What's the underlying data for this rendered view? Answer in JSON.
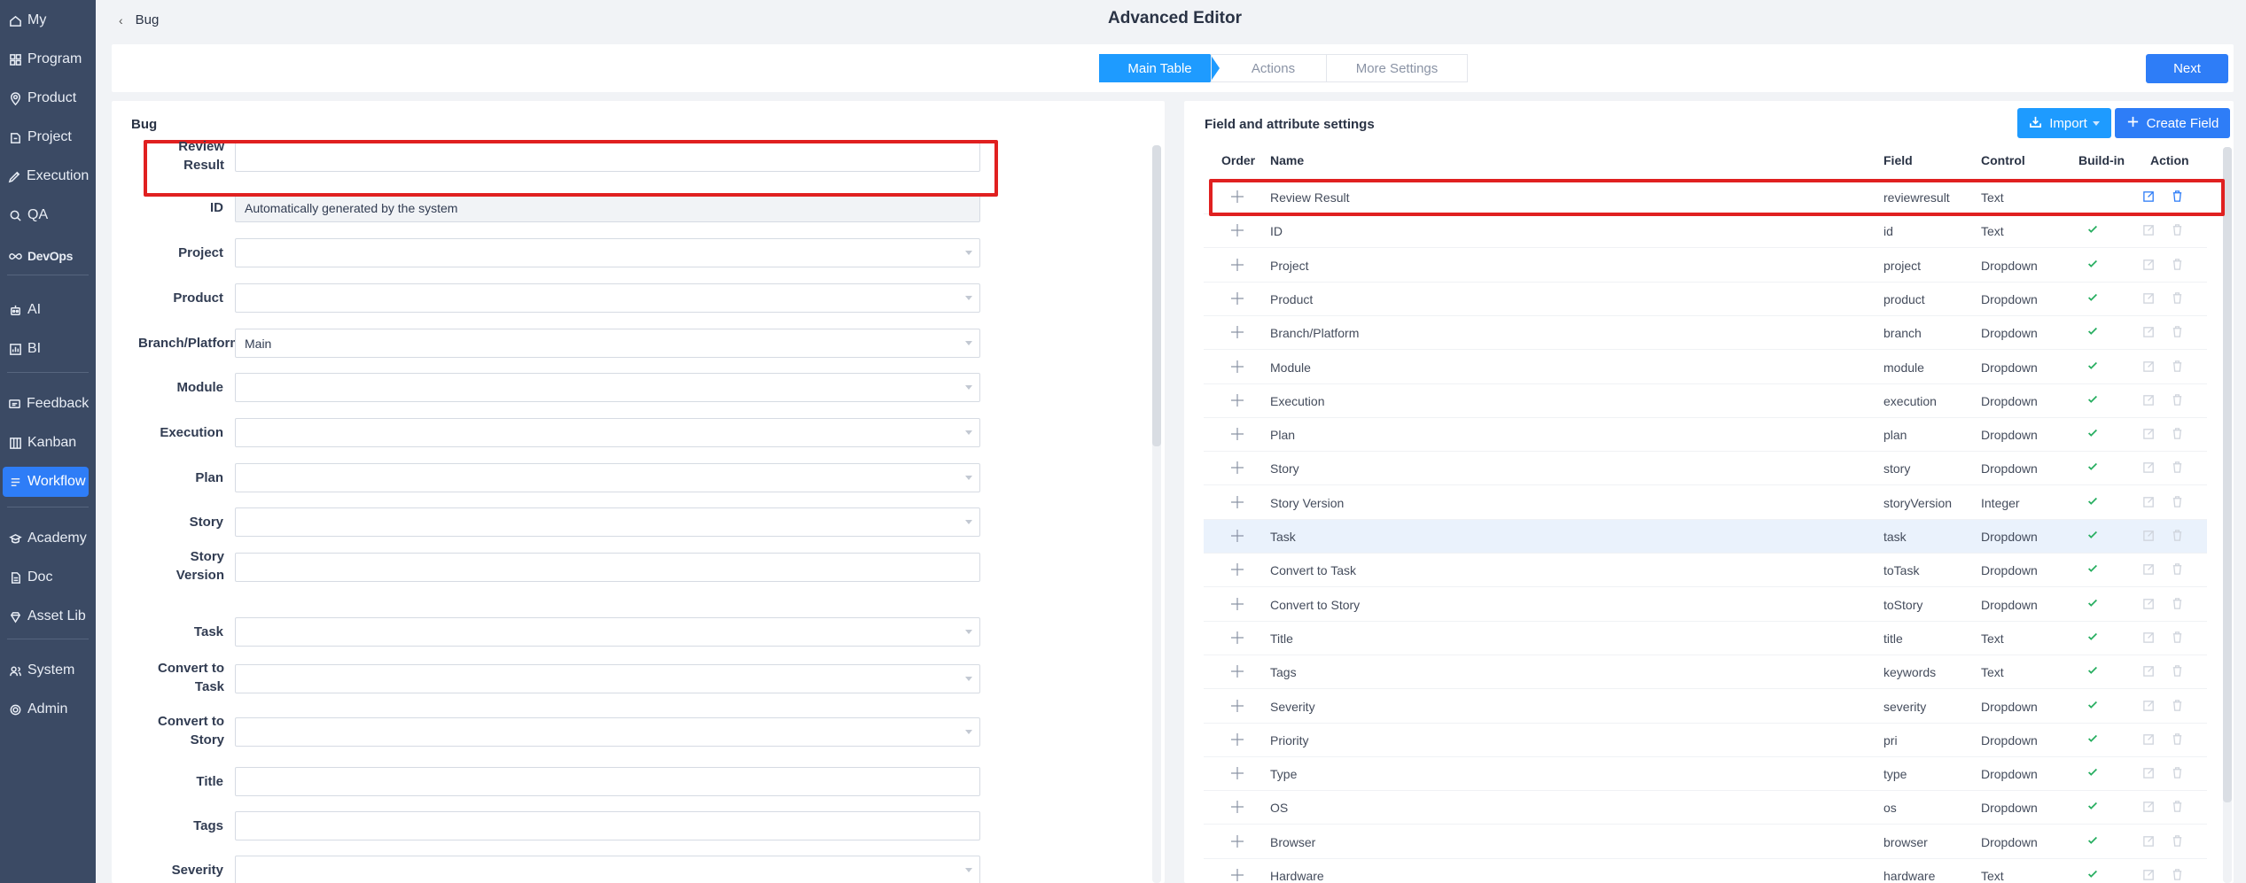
{
  "sidebar": {
    "items": [
      {
        "label": "My",
        "icon": "home-icon"
      },
      {
        "label": "Program",
        "icon": "grid-icon"
      },
      {
        "label": "Product",
        "icon": "pin-icon"
      },
      {
        "label": "Project",
        "icon": "project-icon"
      },
      {
        "label": "Execution",
        "icon": "rocket-icon"
      },
      {
        "label": "QA",
        "icon": "search-icon"
      },
      {
        "label": "DevOps",
        "icon": "infinity-icon"
      },
      {
        "label": "AI",
        "icon": "robot-icon"
      },
      {
        "label": "BI",
        "icon": "chart-icon"
      },
      {
        "label": "Feedback",
        "icon": "feedback-icon"
      },
      {
        "label": "Kanban",
        "icon": "kanban-icon"
      },
      {
        "label": "Workflow",
        "icon": "workflow-icon"
      },
      {
        "label": "Academy",
        "icon": "academy-icon"
      },
      {
        "label": "Doc",
        "icon": "doc-icon"
      },
      {
        "label": "Asset Lib",
        "icon": "diamond-icon"
      },
      {
        "label": "System",
        "icon": "users-icon"
      },
      {
        "label": "Admin",
        "icon": "gear-icon"
      }
    ]
  },
  "header": {
    "back_label": "Bug",
    "title": "Advanced Editor"
  },
  "steps": [
    "Main Table",
    "Actions",
    "More Settings"
  ],
  "next_label": "Next",
  "form": {
    "title": "Bug",
    "fields": [
      {
        "label": "Review Result",
        "value": "",
        "type": "text"
      },
      {
        "label": "ID",
        "value": "Automatically generated by the system",
        "type": "disabled"
      },
      {
        "label": "Project",
        "value": "",
        "type": "select"
      },
      {
        "label": "Product",
        "value": "",
        "type": "select"
      },
      {
        "label": "Branch/Platform",
        "value": "Main",
        "type": "select"
      },
      {
        "label": "Module",
        "value": "",
        "type": "select"
      },
      {
        "label": "Execution",
        "value": "",
        "type": "select"
      },
      {
        "label": "Plan",
        "value": "",
        "type": "select"
      },
      {
        "label": "Story",
        "value": "",
        "type": "select"
      },
      {
        "label": "Story Version",
        "value": "",
        "type": "text"
      },
      {
        "label": "Task",
        "value": "",
        "type": "select"
      },
      {
        "label": "Convert to Task",
        "value": "",
        "type": "select"
      },
      {
        "label": "Convert to Story",
        "value": "",
        "type": "select"
      },
      {
        "label": "Title",
        "value": "",
        "type": "text"
      },
      {
        "label": "Tags",
        "value": "",
        "type": "text"
      },
      {
        "label": "Severity",
        "value": "",
        "type": "select"
      }
    ]
  },
  "settings": {
    "title": "Field and attribute settings",
    "import_label": "Import",
    "create_label": "Create Field",
    "columns": {
      "order": "Order",
      "name": "Name",
      "field": "Field",
      "control": "Control",
      "builtin": "Build-in",
      "action": "Action"
    },
    "rows": [
      {
        "name": "Review Result",
        "field": "reviewresult",
        "control": "Text",
        "builtin": false
      },
      {
        "name": "ID",
        "field": "id",
        "control": "Text",
        "builtin": true
      },
      {
        "name": "Project",
        "field": "project",
        "control": "Dropdown",
        "builtin": true
      },
      {
        "name": "Product",
        "field": "product",
        "control": "Dropdown",
        "builtin": true
      },
      {
        "name": "Branch/Platform",
        "field": "branch",
        "control": "Dropdown",
        "builtin": true
      },
      {
        "name": "Module",
        "field": "module",
        "control": "Dropdown",
        "builtin": true
      },
      {
        "name": "Execution",
        "field": "execution",
        "control": "Dropdown",
        "builtin": true
      },
      {
        "name": "Plan",
        "field": "plan",
        "control": "Dropdown",
        "builtin": true
      },
      {
        "name": "Story",
        "field": "story",
        "control": "Dropdown",
        "builtin": true
      },
      {
        "name": "Story Version",
        "field": "storyVersion",
        "control": "Integer",
        "builtin": true
      },
      {
        "name": "Task",
        "field": "task",
        "control": "Dropdown",
        "builtin": true
      },
      {
        "name": "Convert to Task",
        "field": "toTask",
        "control": "Dropdown",
        "builtin": true
      },
      {
        "name": "Convert to Story",
        "field": "toStory",
        "control": "Dropdown",
        "builtin": true
      },
      {
        "name": "Title",
        "field": "title",
        "control": "Text",
        "builtin": true
      },
      {
        "name": "Tags",
        "field": "keywords",
        "control": "Text",
        "builtin": true
      },
      {
        "name": "Severity",
        "field": "severity",
        "control": "Dropdown",
        "builtin": true
      },
      {
        "name": "Priority",
        "field": "pri",
        "control": "Dropdown",
        "builtin": true
      },
      {
        "name": "Type",
        "field": "type",
        "control": "Dropdown",
        "builtin": true
      },
      {
        "name": "OS",
        "field": "os",
        "control": "Dropdown",
        "builtin": true
      },
      {
        "name": "Browser",
        "field": "browser",
        "control": "Dropdown",
        "builtin": true
      },
      {
        "name": "Hardware",
        "field": "hardware",
        "control": "Text",
        "builtin": true
      }
    ]
  },
  "colors": {
    "sidebar": "#3b4a64",
    "accent": "#2e7df7",
    "step_active": "#1e9bff",
    "highlight": "#e02020",
    "check": "#27ae60"
  }
}
